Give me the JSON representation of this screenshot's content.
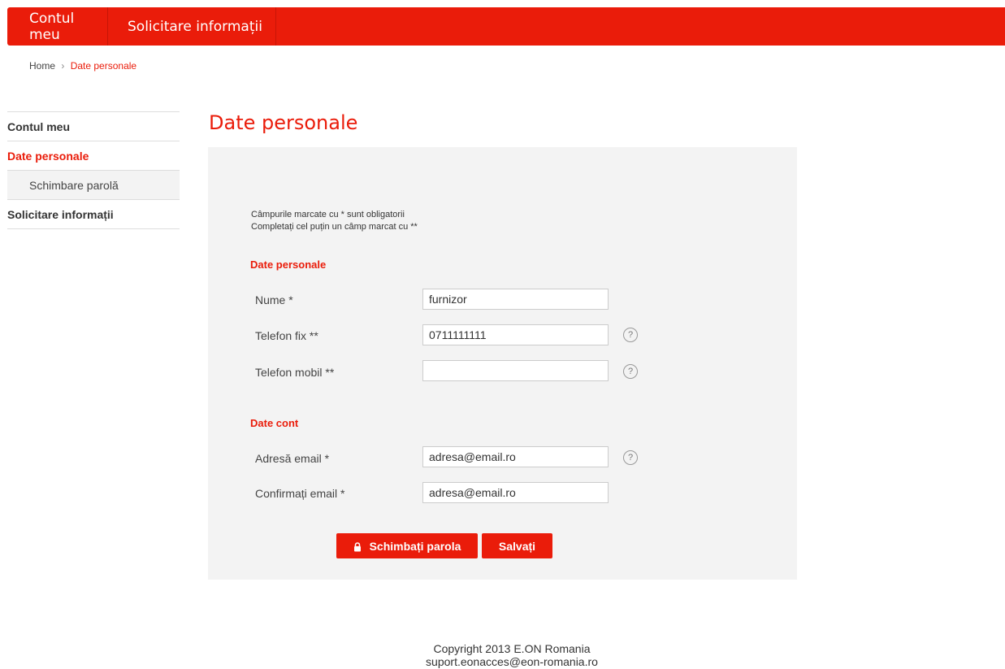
{
  "topnav": {
    "items": [
      "Contul meu",
      "Solicitare informații"
    ]
  },
  "breadcrumb": {
    "home": "Home",
    "separator": "›",
    "current": "Date personale"
  },
  "sidebar": {
    "items": [
      {
        "label": "Contul meu"
      },
      {
        "label": "Date personale"
      },
      {
        "label": "Schimbare parolă"
      },
      {
        "label": "Solicitare informații"
      }
    ]
  },
  "page": {
    "title": "Date personale"
  },
  "form": {
    "note1": "Câmpurile marcate cu * sunt obligatorii",
    "note2": "Completați cel puțin un câmp marcat cu **",
    "section_personal": "Date personale",
    "nume_label": "Nume *",
    "nume_value": "furnizor",
    "tel_fix_label": "Telefon fix **",
    "tel_fix_value": "0711111111",
    "tel_mobil_label": "Telefon mobil **",
    "tel_mobil_value": "",
    "section_account": "Date cont",
    "email_label": "Adresă email *",
    "email_value": "adresa@email.ro",
    "confirm_label": "Confirmați email *",
    "confirm_value": "adresa@email.ro",
    "help_glyph": "?",
    "change_password_label": "Schimbați parola",
    "save_label": "Salvați"
  },
  "footer": {
    "copyright": "Copyright 2013 E.ON Romania",
    "email": "suport.eonacces@eon-romania.ro"
  },
  "colors": {
    "accent": "#ea1c0a",
    "panel": "#f3f3f3"
  }
}
